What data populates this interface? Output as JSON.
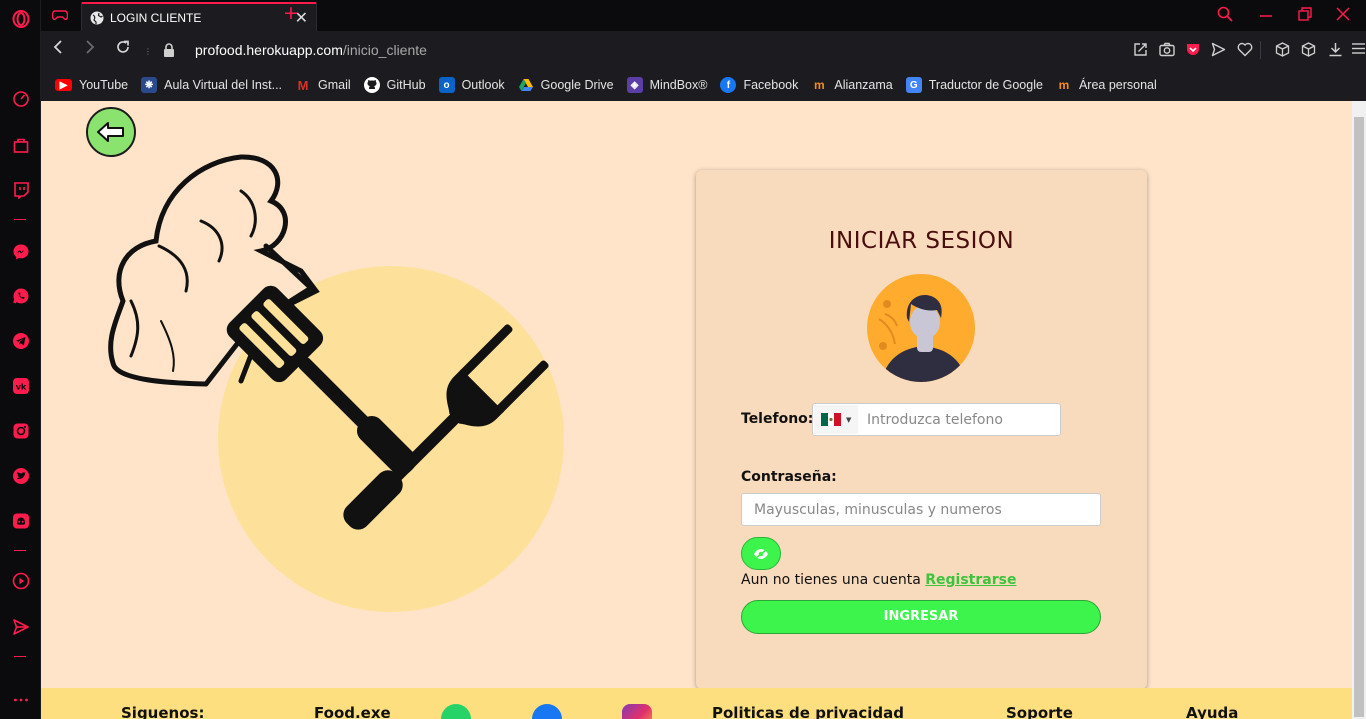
{
  "browser": {
    "tab_title": "LOGIN CLIENTE",
    "url_host": "profood.herokuapp.com",
    "url_path": "/inicio_cliente",
    "accent_color": "#ff1b4b",
    "sidebar_icons": [
      "opera-logo-icon",
      "speed-dial-icon",
      "bag-icon",
      "twitch-icon",
      "messenger-icon",
      "whatsapp-icon",
      "telegram-icon",
      "vk-icon",
      "instagram-icon",
      "twitter-icon",
      "discord-icon",
      "player-icon",
      "send-icon",
      "more-icon"
    ]
  },
  "bookmarks": [
    {
      "label": "YouTube",
      "color": "#ff0000"
    },
    {
      "label": "Aula Virtual del Inst...",
      "color": "#2b4a8c"
    },
    {
      "label": "Gmail",
      "color": "#d93025"
    },
    {
      "label": "GitHub",
      "color": "#333333"
    },
    {
      "label": "Outlook",
      "color": "#0a64c8"
    },
    {
      "label": "Google Drive",
      "color": "#1fa463"
    },
    {
      "label": "MindBox®",
      "color": "#5b3ea6"
    },
    {
      "label": "Facebook",
      "color": "#1877f2"
    },
    {
      "label": "Alianzama",
      "color": "#f28c1e"
    },
    {
      "label": "Traductor de Google",
      "color": "#4285f4"
    },
    {
      "label": "Área personal",
      "color": "#f28c1e"
    }
  ],
  "login": {
    "title": "INICIAR SESION",
    "phone_label": "Telefono:",
    "phone_placeholder": "Introduzca telefono",
    "country_flag": "mexico-flag-icon",
    "password_label": "Contraseña:",
    "password_placeholder": "Mayusculas, minusculas y numeros",
    "no_account_text": "Aun no tienes una cuenta",
    "register_link": "Registrarse",
    "submit_label": "INGRESAR"
  },
  "footer": {
    "follow": "Siguenos:",
    "brand": "Food.exe",
    "privacy": "Politicas de privacidad",
    "support": "Soporte",
    "help": "Ayuda"
  },
  "colors": {
    "page_bg": "#ffe4c9",
    "card_bg": "#f8dbbd",
    "primary_button": "#3cf44c",
    "title": "#4a0d0d",
    "footer_bg": "#fddf7f"
  }
}
